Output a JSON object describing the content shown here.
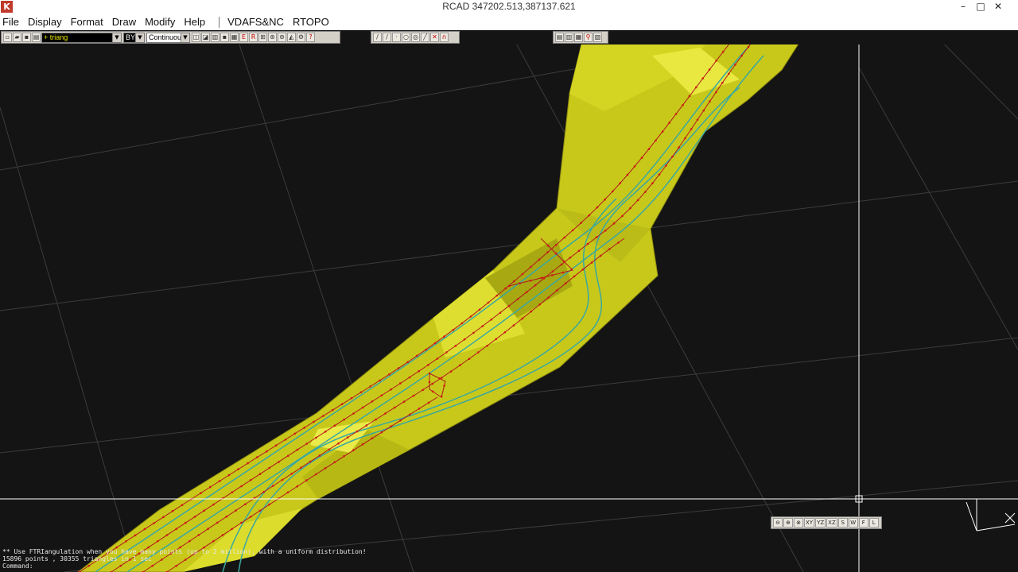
{
  "window": {
    "title": "RCAD  347202.513,387137.621",
    "icon": "rcad-logo-icon",
    "controls": {
      "minimize": "–",
      "maximize": "□",
      "close": "✕"
    }
  },
  "menu": {
    "items": [
      "File",
      "Display",
      "Format",
      "Draw",
      "Modify",
      "Help"
    ],
    "extra_items": [
      "VDAFS&NC",
      "RTOPO"
    ]
  },
  "toolbar": {
    "layer_value": "+ triang",
    "color_value": "BYL",
    "linetype_value": "Continuous",
    "file_buttons": [
      "new-icon",
      "open-icon",
      "save-icon",
      "print-icon"
    ],
    "edit_buttons": [
      "B1",
      "B2",
      "B3",
      "B4",
      "B5",
      "E",
      "R",
      "B8",
      "B9",
      "B10",
      "B11",
      "B12",
      "?"
    ],
    "draw_buttons": [
      "/",
      "∕",
      "·",
      "○",
      "◎",
      "╱",
      "✕",
      "∩"
    ],
    "display_buttons": [
      "▤",
      "▥",
      "▦",
      "⚲",
      "▧"
    ]
  },
  "view_toolbar": {
    "buttons": [
      "⊖",
      "⊕",
      "⊗",
      "XY",
      "YZ",
      "XZ",
      "S",
      "W",
      "F",
      "L"
    ]
  },
  "command_area": {
    "lines": [
      "** Use FTRIangulation when you have many points (up to 2 million), with a uniform distribution!",
      "15896 points , 30355 triangles in 1 sec",
      "Command:"
    ]
  },
  "colors": {
    "background": "#141414",
    "terrain_surface": "#c8c81a",
    "terrain_highlight": "#e0e030",
    "grid_lines": "#3c3c3c",
    "crosshair": "#ffffff",
    "breaklines": "#b01818",
    "road_edges": "#3aa8a0"
  }
}
